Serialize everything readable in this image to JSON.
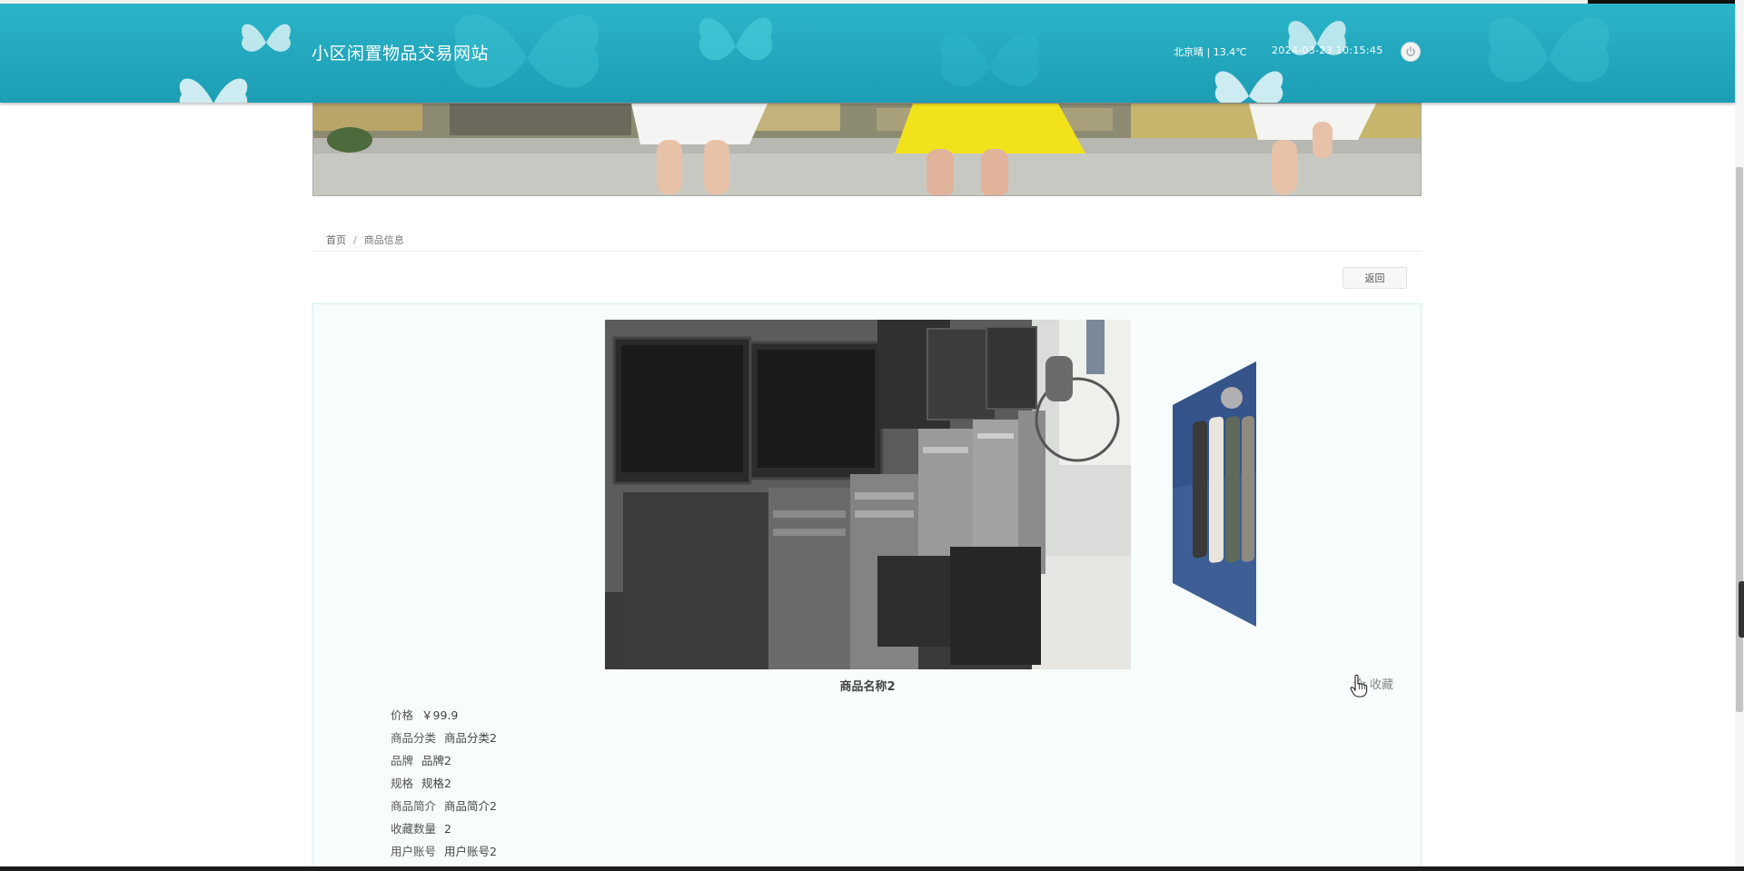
{
  "header": {
    "site_title": "小区闲置物品交易网站",
    "weather": "北京晴 | 13.4℃",
    "datetime": "2024-03-23   10:15:45",
    "power_icon": "power-icon"
  },
  "breadcrumb": {
    "home": "首页",
    "separator": "/",
    "current": "商品信息"
  },
  "actions": {
    "back_label": "返回",
    "favorite_label": "收藏",
    "favorite_icon": "star-icon"
  },
  "product": {
    "name": "商品名称2",
    "attributes": [
      {
        "label": "价格",
        "value": "￥99.9"
      },
      {
        "label": "商品分类",
        "value": "商品分类2"
      },
      {
        "label": "品牌",
        "value": "品牌2"
      },
      {
        "label": "规格",
        "value": "规格2"
      },
      {
        "label": "商品简介",
        "value": "商品简介2"
      },
      {
        "label": "收藏数量",
        "value": "2"
      },
      {
        "label": "用户账号",
        "value": "用户账号2"
      }
    ]
  },
  "colors": {
    "header_bg": "#22a7bd",
    "panel_bg": "#f7fdfd",
    "text": "#555555"
  }
}
